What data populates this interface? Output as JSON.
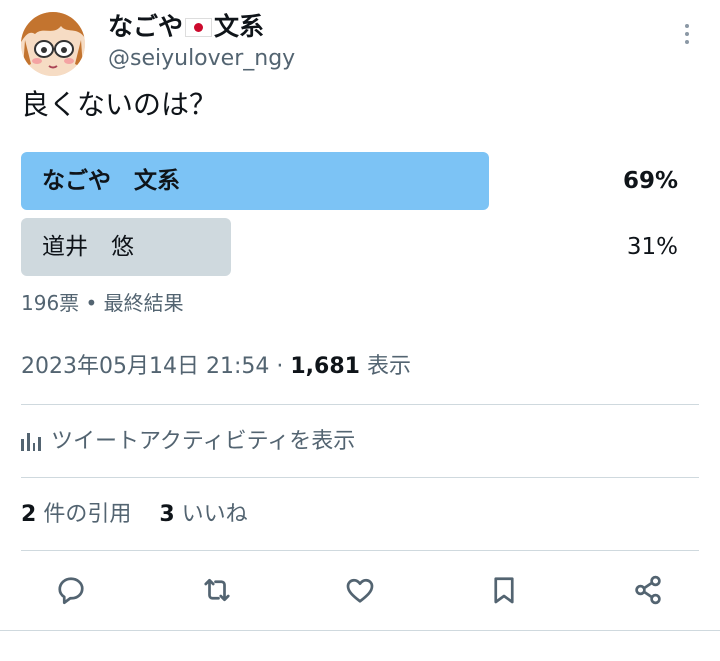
{
  "author": {
    "display_name_part1": "なごや",
    "flag_icon": "japan-flag-icon",
    "display_name_part2": "文系",
    "handle": "@seiyulover_ngy",
    "avatar_icon": "cartoon-avatar-icon"
  },
  "tweet": {
    "text": "良くないのは？"
  },
  "poll": {
    "options": [
      {
        "label": "なごや　文系",
        "percent": "69%",
        "value": 69,
        "winner": true
      },
      {
        "label": "道井　悠",
        "percent": "31%",
        "value": 31,
        "winner": false
      }
    ],
    "meta": "196票 • 最終結果"
  },
  "timestamp": {
    "datetime": "2023年05月14日 21:54",
    "separator": "·",
    "views_count": "1,681",
    "views_label": "表示"
  },
  "activity": {
    "icon": "analytics-icon",
    "label": "ツイートアクティビティを表示"
  },
  "engagements": {
    "quotes_count": "2",
    "quotes_label": "件の引用",
    "likes_count": "3",
    "likes_label": "いいね"
  },
  "actions": [
    "reply-icon",
    "retweet-icon",
    "like-icon",
    "bookmark-icon",
    "share-icon"
  ],
  "colors": {
    "poll_winner_bar": "#7cc3f5",
    "poll_other_bar": "#cfd9de",
    "secondary_text": "#536471",
    "primary_text": "#0f1419",
    "flag_red": "#cc0a2d"
  }
}
